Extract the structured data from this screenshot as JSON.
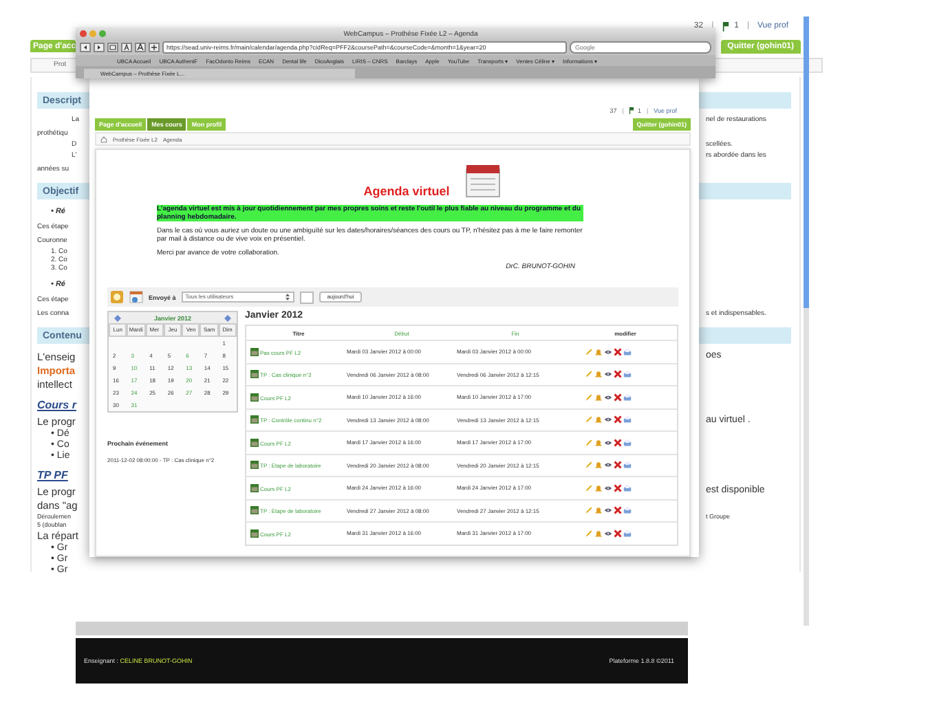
{
  "background_page": {
    "printer_count": "32",
    "separator_1": "|",
    "flag_count": "1",
    "separator_2": "|",
    "view_link": "Vue prof",
    "home_tab": "Page d'acc",
    "quit_tab": "Quitter (gohin01)",
    "breadcrumb": "Prot",
    "rows": [
      {
        "kind": "header",
        "left": "Descript"
      },
      {
        "kind": "indent",
        "left": "La",
        "right": "nel de restaurations"
      },
      {
        "kind": "small",
        "left": "prothétiqu"
      },
      {
        "kind": "indent",
        "left": "D",
        "right": "scellées."
      },
      {
        "kind": "indent",
        "left": "L'",
        "right": "rs abordée dans les"
      },
      {
        "kind": "small",
        "left": "années su"
      },
      {
        "kind": "header",
        "left": "Objectif"
      },
      {
        "kind": "bullet",
        "left": "• Ré"
      },
      {
        "kind": "small",
        "left": "Ces étape"
      },
      {
        "kind": "small",
        "left": "Couronne"
      },
      {
        "kind": "number",
        "left": "1. Co"
      },
      {
        "kind": "number",
        "left": "2. Co"
      },
      {
        "kind": "number",
        "left": "3. Co"
      },
      {
        "kind": "bullet",
        "left": "• Ré"
      },
      {
        "kind": "small",
        "left": "Ces étape"
      },
      {
        "kind": "small",
        "left": "Les conna",
        "right": "s et indispensables."
      },
      {
        "kind": "header",
        "left": "Contenu"
      },
      {
        "kind": "large",
        "left": "L'enseig",
        "right": "oes"
      },
      {
        "kind": "orange",
        "left": "Importa"
      },
      {
        "kind": "large",
        "left": "intellect"
      },
      {
        "kind": "link",
        "left": "Cours r"
      },
      {
        "kind": "large",
        "left": "Le progr",
        "right": "au virtuel ."
      },
      {
        "kind": "bigbullet",
        "left": "• Dé"
      },
      {
        "kind": "bigbullet",
        "left": "• Co"
      },
      {
        "kind": "bigbullet",
        "left": "• Lie"
      },
      {
        "kind": "link",
        "left": "TP PF"
      },
      {
        "kind": "large",
        "left": "Le progr",
        "right": "est disponible"
      },
      {
        "kind": "large",
        "left": "dans \"ag"
      },
      {
        "kind": "tiny",
        "left": "Déroulemen",
        "right": "t Groupe"
      },
      {
        "kind": "tiny",
        "left": "5 (doublan"
      },
      {
        "kind": "large",
        "left": "La répart"
      },
      {
        "kind": "bigbullet",
        "left": "• Gr"
      },
      {
        "kind": "bigbullet",
        "left": "• Gr"
      },
      {
        "kind": "bigbullet",
        "left": "• Gr"
      }
    ],
    "footer": {
      "teacher_label": "Enseignant :",
      "teacher": "CELINE BRUNOT-GOHIN",
      "platform": "Plateforme 1.8.8 ©2011"
    }
  },
  "browser": {
    "title": "WebCampus – Prothèse Fixée L2 – Agenda",
    "url": "https://sead.univ-reims.fr/main/calendar/agenda.php?cidReq=PFF2&coursePath=&courseCode=&month=1&year=20",
    "search_placeholder": "Google",
    "bookmarks": [
      "UBCA Accueil",
      "UBCA AuthentF",
      "FacOdonto Reims",
      "ECAN",
      "Dental life",
      "DicoAnglais",
      "LIRIS – CNRS",
      "Barclays",
      "Apple",
      "YouTube",
      "Transports ▾",
      "Ventes Céline ▾",
      "Informations ▾"
    ],
    "tab": "WebCampus – Prothèse Fixée L...",
    "page": {
      "printer_count": "37",
      "separator_1": "|",
      "flag_count": "1",
      "separator_2": "|",
      "view_link": "Vue prof",
      "tabs": [
        {
          "label": "Page d'accueil",
          "selected": false
        },
        {
          "label": "Mes cours",
          "selected": true
        },
        {
          "label": "Mon profil",
          "selected": false
        }
      ],
      "quit": "Quitter (gohin01)",
      "breadcrumb": [
        "Prothèse Fixée L2",
        "Agenda"
      ],
      "title": "Agenda virtuel",
      "highlight": "L'agenda virtuel est mis à jour quotidiennement par mes propres soins et reste l'outil le plus fiable au niveau du programme et du planning hebdomadaire.",
      "paragraphs": [
        "Dans le cas où vous auriez un doute ou une ambiguïté sur les dates/horaires/séances des cours ou TP, n'hésitez pas à me le faire remonter par mail à distance ou de vive voix en présentiel.",
        "Merci par avance de votre collaboration."
      ],
      "signature": "DrC. BRUNOT-GOHIN",
      "sent_to_label": "Envoyé à",
      "recipients": "Tous les utilisateurs",
      "today_button": "aujourd'hui",
      "calendar": {
        "month": "Janvier 2012",
        "days": [
          "Lun",
          "Mardi",
          "Mer",
          "Jeu",
          "Ven",
          "Sam",
          "Dim"
        ],
        "weeks": [
          [
            {
              "kind": "blank"
            },
            {
              "kind": "blank"
            },
            {
              "kind": "blank"
            },
            {
              "kind": "blank"
            },
            {
              "kind": "blank"
            },
            {
              "kind": "blank"
            },
            {
              "kind": "day",
              "day": "1",
              "event": false
            }
          ],
          [
            {
              "kind": "day",
              "day": "2",
              "event": false
            },
            {
              "kind": "day",
              "day": "3",
              "event": true
            },
            {
              "kind": "day",
              "day": "4",
              "event": false
            },
            {
              "kind": "day",
              "day": "5",
              "event": false
            },
            {
              "kind": "day",
              "day": "6",
              "event": true
            },
            {
              "kind": "day",
              "day": "7",
              "event": false
            },
            {
              "kind": "day",
              "day": "8",
              "event": false
            }
          ],
          [
            {
              "kind": "day",
              "day": "9",
              "event": false
            },
            {
              "kind": "day",
              "day": "10",
              "event": true
            },
            {
              "kind": "day",
              "day": "11",
              "event": false
            },
            {
              "kind": "day",
              "day": "12",
              "event": false
            },
            {
              "kind": "day",
              "day": "13",
              "event": true
            },
            {
              "kind": "day",
              "day": "14",
              "event": false
            },
            {
              "kind": "day",
              "day": "15",
              "event": false
            }
          ],
          [
            {
              "kind": "day",
              "day": "16",
              "event": false
            },
            {
              "kind": "day",
              "day": "17",
              "event": true
            },
            {
              "kind": "day",
              "day": "18",
              "event": false
            },
            {
              "kind": "day",
              "day": "19",
              "event": false
            },
            {
              "kind": "day",
              "day": "20",
              "event": true
            },
            {
              "kind": "day",
              "day": "21",
              "event": false
            },
            {
              "kind": "day",
              "day": "22",
              "event": false
            }
          ],
          [
            {
              "kind": "day",
              "day": "23",
              "event": false
            },
            {
              "kind": "day",
              "day": "24",
              "event": true
            },
            {
              "kind": "day",
              "day": "25",
              "event": false
            },
            {
              "kind": "day",
              "day": "26",
              "event": false
            },
            {
              "kind": "day",
              "day": "27",
              "event": true
            },
            {
              "kind": "day",
              "day": "28",
              "event": false
            },
            {
              "kind": "day",
              "day": "29",
              "event": false
            }
          ],
          [
            {
              "kind": "day",
              "day": "30",
              "event": false
            },
            {
              "kind": "day",
              "day": "31",
              "event": true
            },
            {
              "kind": "blank"
            },
            {
              "kind": "blank"
            },
            {
              "kind": "blank"
            },
            {
              "kind": "blank"
            },
            {
              "kind": "blank"
            }
          ]
        ]
      },
      "next_event_label": "Prochain événement",
      "next_event": "2011-12-02 08:00:00 - TP : Cas clinique n°2",
      "list_title": "Janvier 2012",
      "columns": [
        "Titre",
        "Début",
        "Fin",
        "modifier"
      ],
      "events": [
        {
          "title": "Pas cours PF L2",
          "start": "Mardi 03 Janvier 2012 à 00:00",
          "end": "Mardi 03 Janvier 2012 à 00:00"
        },
        {
          "title": "TP : Cas clinique n°2",
          "start": "Vendredi 06 Janvier 2012 à 08:00",
          "end": "Vendredi 06 Janvier 2012 à 12:15"
        },
        {
          "title": "Cours PF L2",
          "start": "Mardi 10 Janvier 2012 à 16:00",
          "end": "Mardi 10 Janvier 2012 à 17:00"
        },
        {
          "title": "TP : Contrôle continu n°2",
          "start": "Vendredi 13 Janvier 2012 à 08:00",
          "end": "Vendredi 13 Janvier 2012 à 12:15"
        },
        {
          "title": "Cours PF L2",
          "start": "Mardi 17 Janvier 2012 à 16:00",
          "end": "Mardi 17 Janvier 2012 à 17:00"
        },
        {
          "title": "TP : Etape de laboratoire",
          "start": "Vendredi 20 Janvier 2012 à 08:00",
          "end": "Vendredi 20 Janvier 2012 à 12:15"
        },
        {
          "title": "Cours PF L2",
          "start": "Mardi 24 Janvier 2012 à 16:00",
          "end": "Mardi 24 Janvier 2012 à 17:00"
        },
        {
          "title": "TP : Etape de laboratoire",
          "start": "Vendredi 27 Janvier 2012 à 08:00",
          "end": "Vendredi 27 Janvier 2012 à 12:15"
        },
        {
          "title": "Cours PF L2",
          "start": "Mardi 31 Janvier 2012 à 16:00",
          "end": "Mardi 31 Janvier 2012 à 17:00"
        }
      ]
    }
  }
}
